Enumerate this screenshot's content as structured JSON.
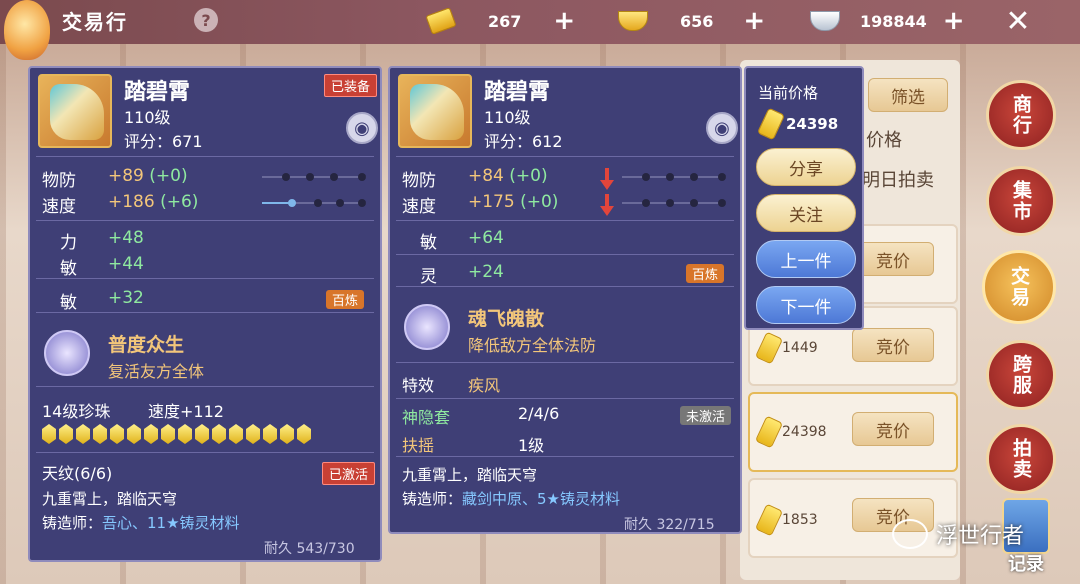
{
  "topbar": {
    "title": "交易行",
    "help": "?",
    "currencies": [
      {
        "icon": "gold-bar-icon",
        "value": "267"
      },
      {
        "icon": "gold-ingot-icon",
        "value": "656"
      },
      {
        "icon": "silver-ingot-icon",
        "value": "198844"
      }
    ],
    "plus": "+"
  },
  "right_nav": [
    "商行",
    "集市",
    "交易",
    "跨服",
    "拍卖"
  ],
  "record_label": "记录",
  "list": {
    "filter": "筛选",
    "price_header": "价格",
    "tomorrow": "明日拍卖",
    "bid_label": "竞价",
    "rows": [
      {
        "price": ""
      },
      {
        "price": "1449"
      },
      {
        "price": "24398"
      },
      {
        "price": "1853"
      }
    ]
  },
  "item_equipped": {
    "name": "踏碧霄",
    "level": "110级",
    "score": "评分：671",
    "badge": "已装备",
    "stats": [
      {
        "label": "物防",
        "value": "+89",
        "delta": "(+0)"
      },
      {
        "label": "速度",
        "value": "+186",
        "delta": "(+6)"
      }
    ],
    "attrs": [
      {
        "label": "力",
        "value": "+48"
      },
      {
        "label": "敏",
        "value": "+44"
      }
    ],
    "refine": {
      "label": "敏",
      "value": "+32",
      "badge": "百炼"
    },
    "skill": {
      "name": "普度众生",
      "desc": "复活友方全体"
    },
    "pearl": {
      "label": "14级珍珠",
      "value": "速度+112"
    },
    "tianwen": {
      "label": "天纹(6/6)",
      "badge": "已激活"
    },
    "poem": "九重霄上，踏临天穹",
    "maker_prefix": "铸造师：",
    "maker": "吾心、11★铸灵材料",
    "durability": "耐久 543/730"
  },
  "item_listed": {
    "name": "踏碧霄",
    "level": "110级",
    "score": "评分：612",
    "stats": [
      {
        "label": "物防",
        "value": "+84",
        "delta": "(+0)"
      },
      {
        "label": "速度",
        "value": "+175",
        "delta": "(+0)"
      }
    ],
    "attrs": [
      {
        "label": "敏",
        "value": "+64"
      }
    ],
    "refine": {
      "label": "灵",
      "value": "+24",
      "badge": "百炼"
    },
    "skill": {
      "name": "魂飞魄散",
      "desc": "降低敌方全体法防"
    },
    "effect": {
      "label": "特效",
      "value": "疾风"
    },
    "set": {
      "label": "神隐套",
      "value": "2/4/6",
      "badge": "未激活"
    },
    "sub": {
      "label": "扶摇",
      "value": "1级"
    },
    "poem": "九重霄上，踏临天穹",
    "maker_prefix": "铸造师：",
    "maker": "藏剑中原、5★铸灵材料",
    "durability": "耐久 322/715"
  },
  "popup": {
    "price_label": "当前价格",
    "price": "24398",
    "buttons": [
      "分享",
      "关注",
      "上一件",
      "下一件"
    ]
  },
  "watermark": "浮世行者",
  "colors": {
    "panel": "#3f3f76",
    "accent_gold": "#f3c67a",
    "green": "#8fe9a0",
    "red": "#c84034"
  }
}
